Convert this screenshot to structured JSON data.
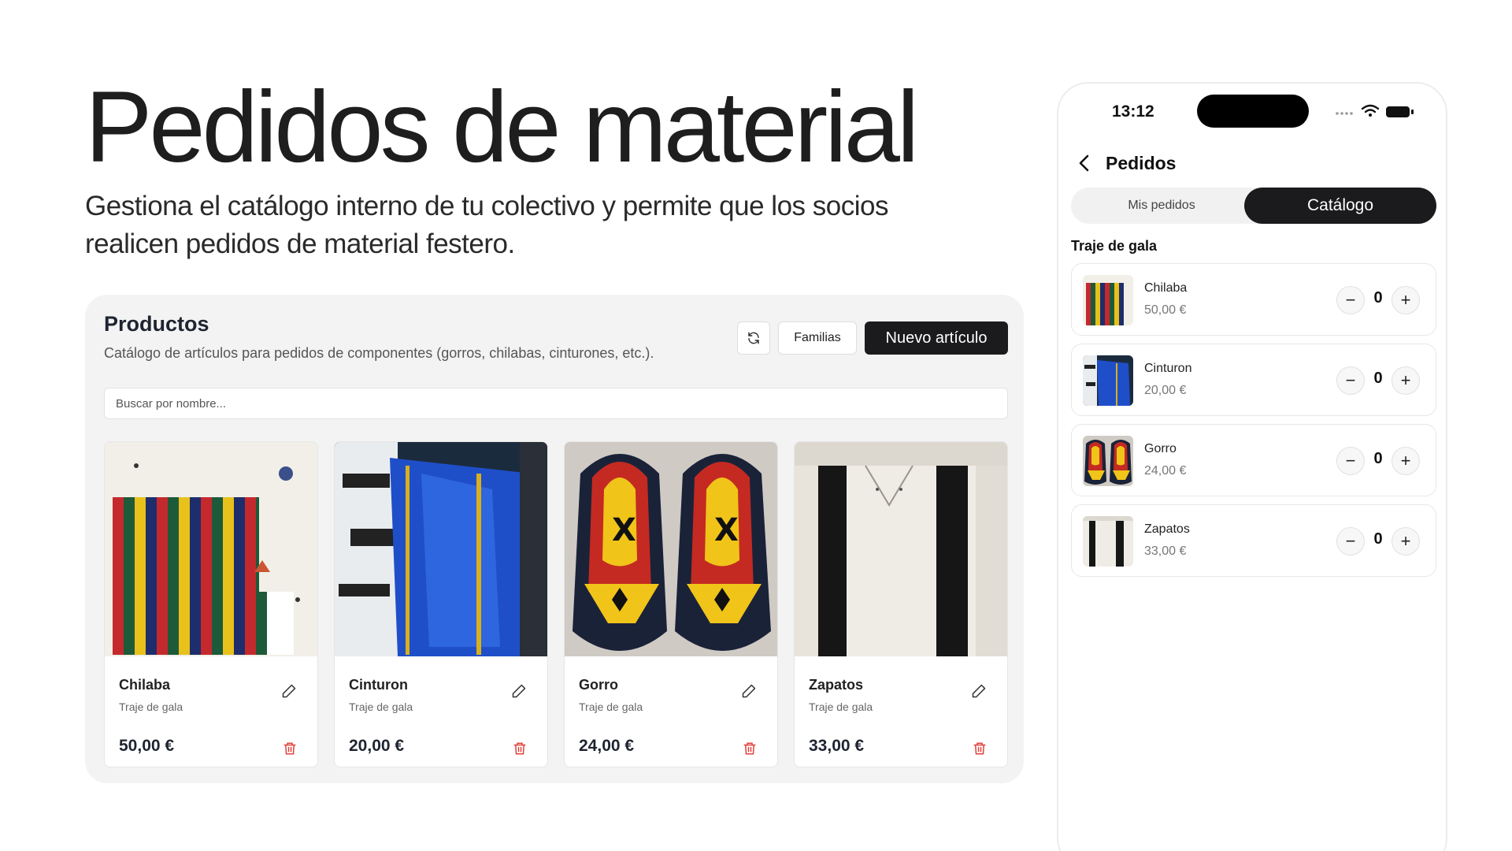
{
  "hero": {
    "title": "Pedidos de material",
    "subtitle": "Gestiona el catálogo interno de tu colectivo y permite que los socios realicen pedidos de material festero."
  },
  "panel": {
    "title": "Productos",
    "description": "Catálogo de artículos para pedidos de componentes (gorros, chilabas, cinturones, etc.).",
    "refresh_icon": "refresh-icon",
    "families_label": "Familias",
    "new_label": "Nuevo artículo",
    "search_placeholder": "Buscar por nombre..."
  },
  "products": [
    {
      "name": "Chilaba",
      "family": "Traje de gala",
      "price": "50,00 €"
    },
    {
      "name": "Cinturon",
      "family": "Traje de gala",
      "price": "20,00 €"
    },
    {
      "name": "Gorro",
      "family": "Traje de gala",
      "price": "24,00 €"
    },
    {
      "name": "Zapatos",
      "family": "Traje de gala",
      "price": "33,00 €"
    }
  ],
  "phone": {
    "time": "13:12",
    "title": "Pedidos",
    "tab_mine": "Mis pedidos",
    "tab_catalog": "Catálogo",
    "section": "Traje de gala",
    "items": [
      {
        "name": "Chilaba",
        "price": "50,00 €",
        "qty": "0"
      },
      {
        "name": "Cinturon",
        "price": "20,00 €",
        "qty": "0"
      },
      {
        "name": "Gorro",
        "price": "24,00 €",
        "qty": "0"
      },
      {
        "name": "Zapatos",
        "price": "33,00 €",
        "qty": "0"
      }
    ],
    "minus": "−",
    "plus": "+"
  },
  "colors": {
    "accent": "#1b1b1d",
    "danger": "#e0413a",
    "panel_bg": "#f3f3f3"
  }
}
